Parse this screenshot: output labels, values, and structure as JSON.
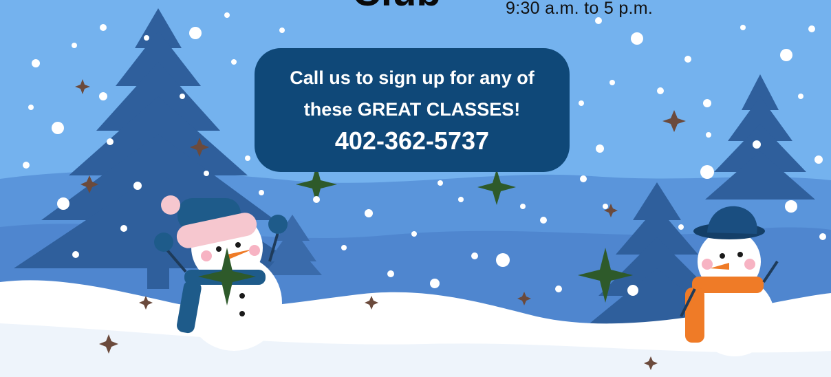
{
  "header": {
    "title_partial": "Club",
    "hours": "9:30 a.m. to 5 p.m."
  },
  "callout": {
    "line1": "Call us to sign up for any of",
    "line2": "these GREAT CLASSES!",
    "phone": "402-362-5737"
  },
  "colors": {
    "sky": "#74b2ee",
    "callout_bg": "#0f4878",
    "tree": "#2f5f9c",
    "snow": "#ffffff"
  }
}
